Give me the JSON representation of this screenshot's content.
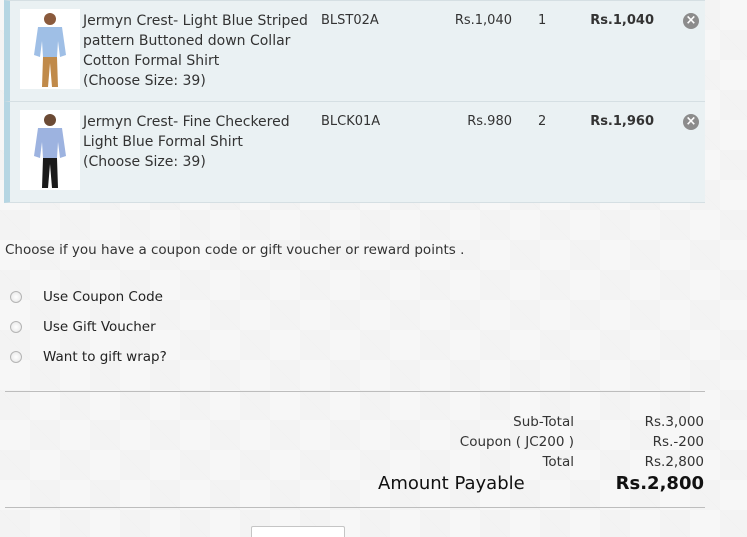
{
  "cart": {
    "items": [
      {
        "name": "Jermyn Crest- Light Blue Striped pattern Buttoned down Collar Cotton Formal Shirt",
        "size": "(Choose Size: 39)",
        "sku": "BLST02A",
        "price": "Rs.1,040",
        "qty": "1",
        "total": "Rs.1,040",
        "remove_icon": "close-circle-icon",
        "shirt_color": "#9fbfe6",
        "pants_color": "#c08a4a"
      },
      {
        "name": "Jermyn Crest- Fine Checkered Light Blue Formal Shirt",
        "size": "(Choose Size: 39)",
        "sku": "BLCK01A",
        "price": "Rs.980",
        "qty": "2",
        "total": "Rs.1,960",
        "remove_icon": "close-circle-icon",
        "shirt_color": "#9db3e0",
        "pants_color": "#1a1a1a"
      }
    ]
  },
  "discounts": {
    "prompt": "Choose if you have a coupon code or gift voucher or reward points .",
    "options": [
      "Use Coupon Code",
      "Use Gift Voucher",
      "Want to gift wrap?"
    ]
  },
  "totals": {
    "subtotal_label": "Sub-Total",
    "subtotal_value": "Rs.3,000",
    "coupon_label": "Coupon ( JC200 )",
    "coupon_value": "Rs.-200",
    "total_label": "Total",
    "total_value": "Rs.2,800",
    "payable_label": "Amount Payable",
    "payable_value": "Rs.2,800"
  },
  "colors": {
    "row_bg": "#eaf1f3",
    "accent_border": "#b6d6e3"
  }
}
